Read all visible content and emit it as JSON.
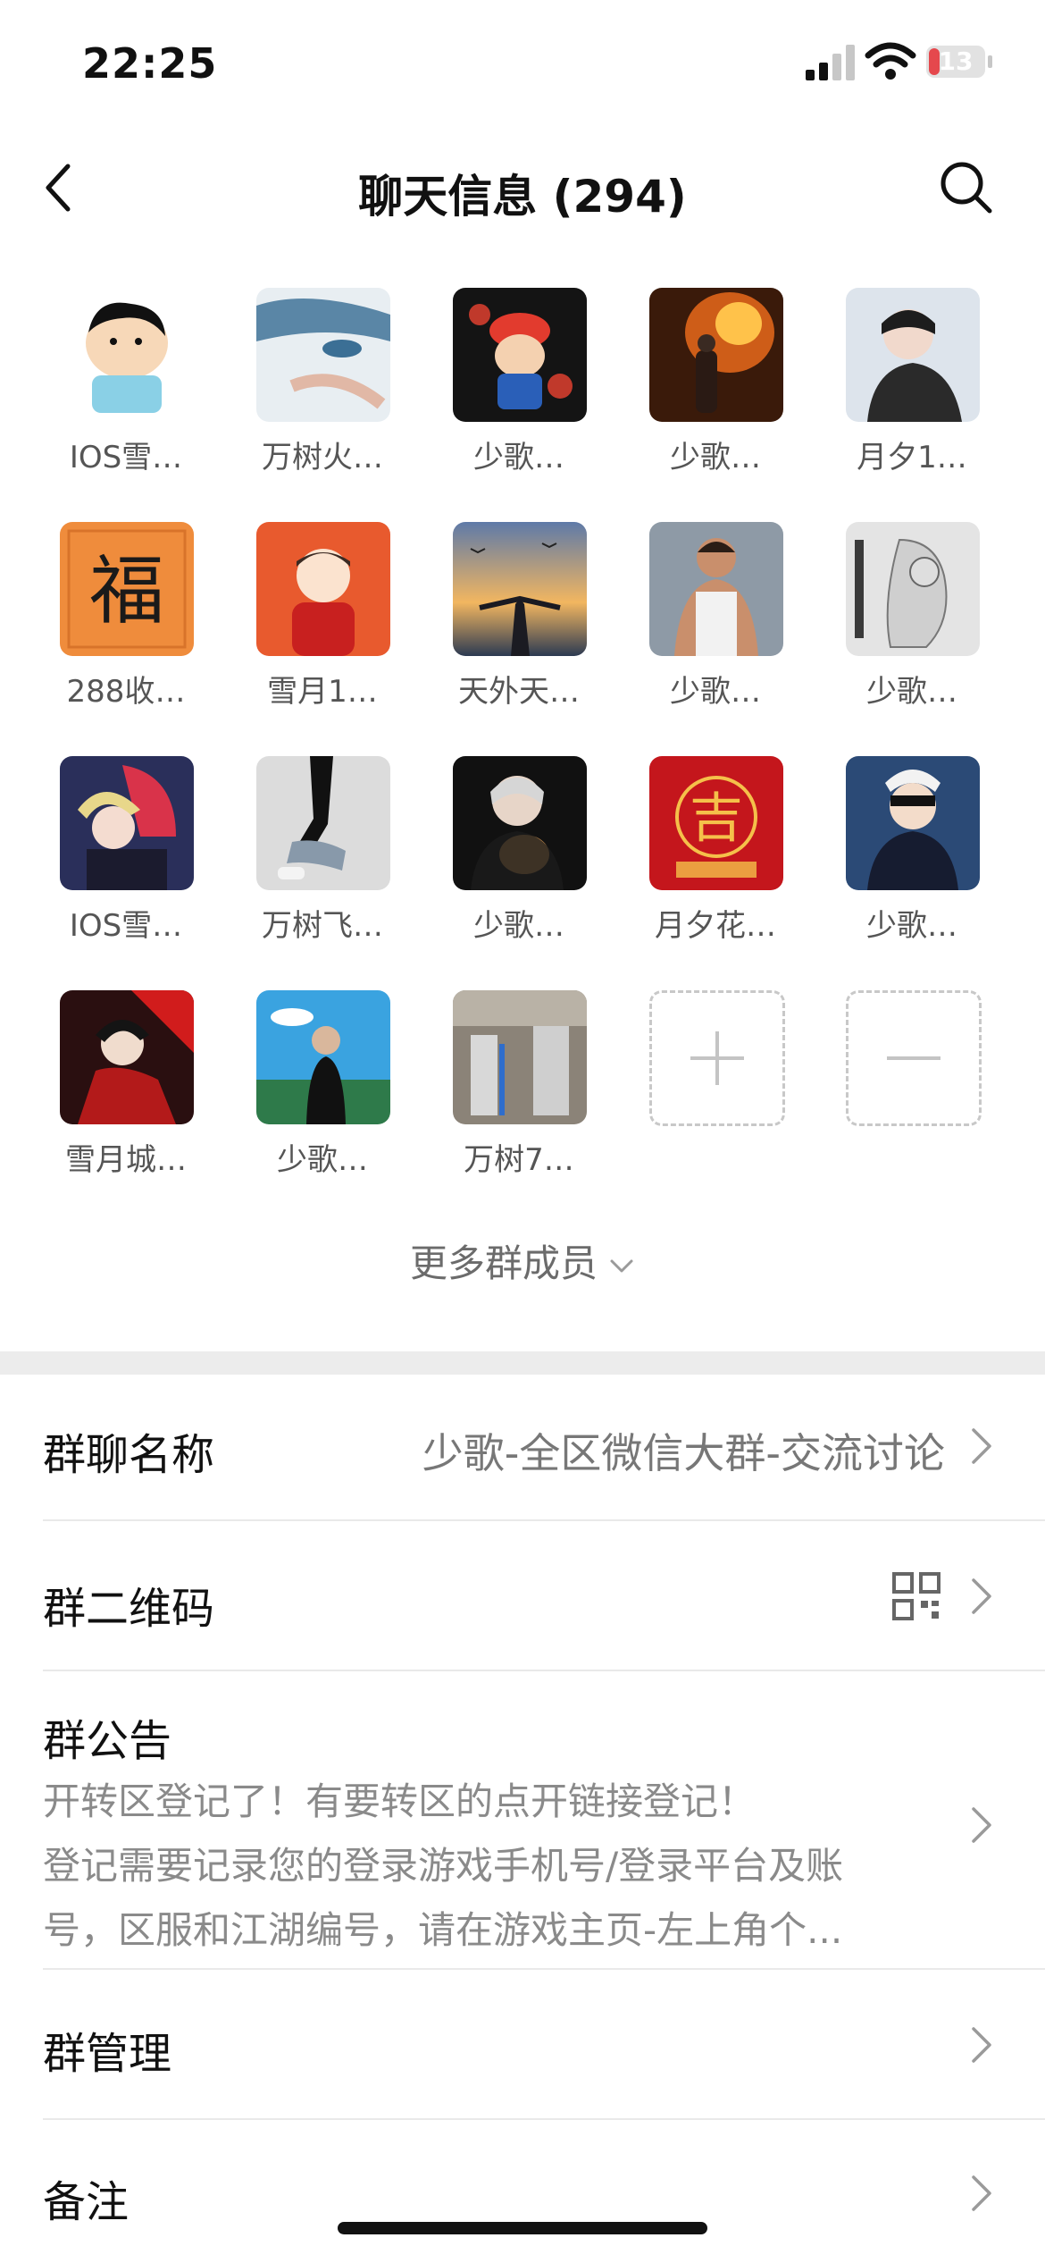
{
  "status": {
    "time": "22:25",
    "battery": "13",
    "battery_color": "#e5484d"
  },
  "nav": {
    "title": "聊天信息 (294)"
  },
  "members": [
    {
      "name": "IOS雪…",
      "avatar": "crayon-shin"
    },
    {
      "name": "万树火…",
      "avatar": "anime-face"
    },
    {
      "name": "少歌…",
      "avatar": "mario"
    },
    {
      "name": "少歌…",
      "avatar": "fire-person"
    },
    {
      "name": "月夕1…",
      "avatar": "boy-dark"
    },
    {
      "name": "288收…",
      "avatar": "fu-character"
    },
    {
      "name": "雪月1…",
      "avatar": "cartoon-boy"
    },
    {
      "name": "天外天…",
      "avatar": "sunset-birds"
    },
    {
      "name": "少歌…",
      "avatar": "muscle-man"
    },
    {
      "name": "少歌…",
      "avatar": "sketch-warrior"
    },
    {
      "name": "IOS雪…",
      "avatar": "anime-couple"
    },
    {
      "name": "万树飞…",
      "avatar": "legs-photo"
    },
    {
      "name": "少歌…",
      "avatar": "boy-dog"
    },
    {
      "name": "月夕花…",
      "avatar": "red-ji-seal"
    },
    {
      "name": "少歌…",
      "avatar": "anime-blindfold"
    },
    {
      "name": "雪月城…",
      "avatar": "anime-red"
    },
    {
      "name": "少歌…",
      "avatar": "boy-sky"
    },
    {
      "name": "万树7…",
      "avatar": "factory"
    }
  ],
  "more_members": "更多群成员",
  "rows": {
    "group_name": {
      "label": "群聊名称",
      "value": "少歌-全区微信大群-交流讨论"
    },
    "qr_code": {
      "label": "群二维码"
    },
    "notice": {
      "label": "群公告",
      "lines": [
        "开转区登记了！有要转区的点开链接登记！",
        "登记需要记录您的登录游戏手机号/登录平台及账",
        "号，区服和江湖编号，请在游戏主页-左上角个..."
      ]
    },
    "manage": {
      "label": "群管理"
    },
    "remark": {
      "label": "备注"
    }
  }
}
